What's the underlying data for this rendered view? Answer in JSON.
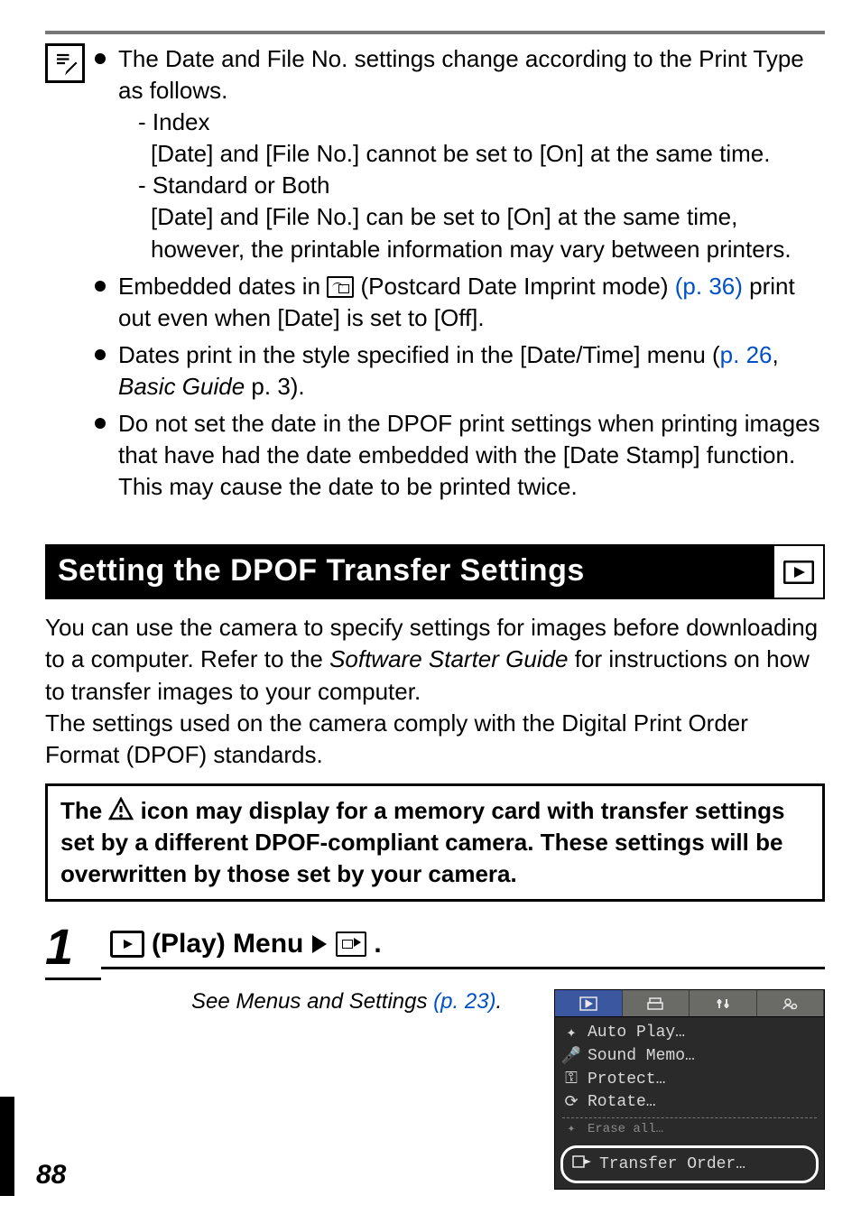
{
  "notes": {
    "item1_lead": "The Date and File No. settings change according to the Print Type as follows.",
    "sub1_title": "Index",
    "sub1_body": "[Date] and [File No.] cannot be set to [On] at the same time.",
    "sub2_title": "Standard or Both",
    "sub2_body": "[Date] and [File No.] can be set to [On] at the same time, however, the printable information may vary between printers.",
    "item2_a": "Embedded dates in ",
    "item2_b": " (Postcard Date Imprint mode) ",
    "item2_link": "(p. 36)",
    "item2_c": " print out even when [Date] is set to [Off].",
    "item3_a": "Dates print in the style specified in the [Date/Time] menu (",
    "item3_link": "p. 26",
    "item3_b": ", ",
    "item3_ital": "Basic Guide",
    "item3_c": " p. 3).",
    "item4": "Do not set the date in the DPOF print settings when printing images that have had the date embedded with the [Date Stamp] function. This may cause the date to be printed twice."
  },
  "section_title": "Setting the DPOF Transfer Settings",
  "intro_a": "You can use the camera to specify settings for images before downloading to a computer. Refer to the ",
  "intro_ital": "Software Starter Guide",
  "intro_b": " for instructions on how to transfer images to your computer.",
  "intro_c": "The settings used on the camera comply with the Digital Print Order Format (DPOF) standards.",
  "warn_a": "The ",
  "warn_b": " icon may display for a memory card with transfer settings set by a different DPOF-compliant camera. These settings will be overwritten by those set by your camera.",
  "step_num": "1",
  "step_label_a": " (Play) Menu",
  "step_label_dot": ".",
  "see_menus_a": "See Menus and Settings ",
  "see_menus_link": "(p. 23)",
  "see_menus_dot": ".",
  "lcd": {
    "rows": [
      {
        "icon": "autoplay",
        "label": "Auto Play…"
      },
      {
        "icon": "mic",
        "label": "Sound Memo…"
      },
      {
        "icon": "key",
        "label": "Protect…"
      },
      {
        "icon": "rotate",
        "label": "Rotate…"
      }
    ],
    "faded": "Erase all…",
    "highlight": "Transfer Order…"
  },
  "page_number": "88"
}
